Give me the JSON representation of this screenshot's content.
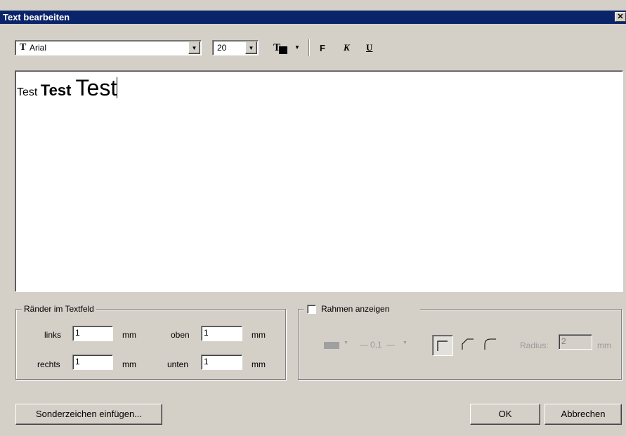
{
  "window": {
    "title": "Text bearbeiten",
    "close_label": "✕"
  },
  "toolbar": {
    "font_icon": "T",
    "font_value": "Arial",
    "size_value": "20",
    "color_icon": "text-color-icon",
    "bold_label": "F",
    "italic_label": "K",
    "underline_label": "U"
  },
  "editor": {
    "run1": "Test ",
    "run2": "Test ",
    "run3": "Test"
  },
  "margins": {
    "legend": "Ränder im Textfeld",
    "links_label": "links",
    "links_value": "1",
    "rechts_label": "rechts",
    "rechts_value": "1",
    "oben_label": "oben",
    "oben_value": "1",
    "unten_label": "unten",
    "unten_value": "1",
    "unit": "mm"
  },
  "frame": {
    "checkbox_label": "Rahmen anzeigen",
    "line_width": "0,1",
    "radius_label": "Radius:",
    "radius_value": "2",
    "unit": "mm"
  },
  "buttons": {
    "special_chars": "Sonderzeichen einfügen...",
    "ok": "OK",
    "cancel": "Abbrechen"
  },
  "colors": {
    "titlebar": "#0a246a",
    "face": "#d4d0c8"
  }
}
